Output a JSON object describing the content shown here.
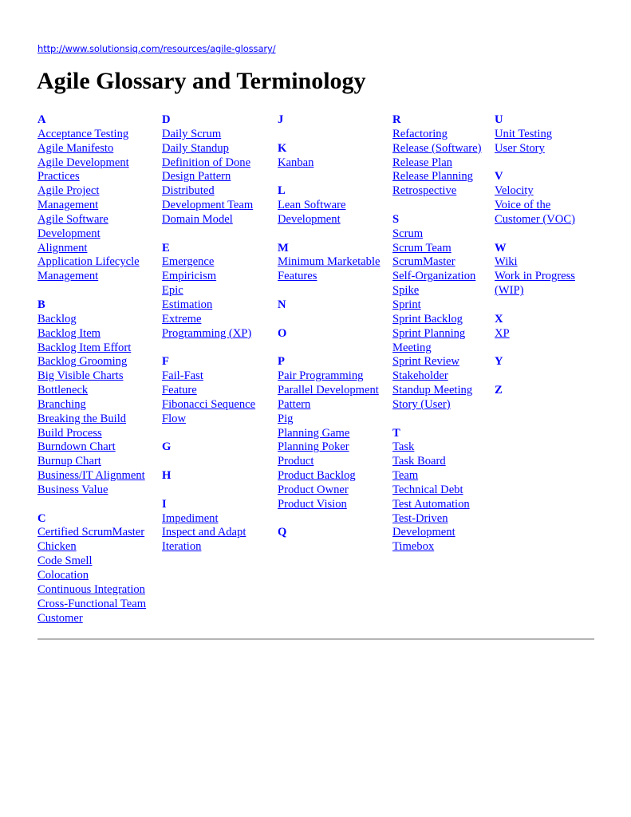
{
  "header": {
    "url": "http://www.solutionsiq.com/resources/agile-glossary/",
    "title": "Agile Glossary and Terminology"
  },
  "colors": {
    "link": "#0000ff",
    "title": "#000000",
    "rule": "#b5b5b5"
  },
  "columns": [
    [
      {
        "letter": "A",
        "terms": [
          [
            "Acceptance Testing"
          ],
          [
            "Agile Manifesto"
          ],
          [
            "Agile Development",
            "Practices"
          ],
          [
            "Agile Project",
            "Management"
          ],
          [
            "Agile Software",
            "Development"
          ],
          [
            "Alignment"
          ],
          [
            "Application Lifecycle",
            "Management"
          ]
        ]
      },
      {
        "letter": "B",
        "terms": [
          [
            "Backlog"
          ],
          [
            "Backlog Item"
          ],
          [
            "Backlog Item Effort"
          ],
          [
            "Backlog Grooming"
          ],
          [
            "Big Visible Charts"
          ],
          [
            "Bottleneck"
          ],
          [
            "Branching"
          ],
          [
            "Breaking the Build"
          ],
          [
            "Build Process"
          ],
          [
            "Burndown Chart"
          ],
          [
            "Burnup Chart"
          ],
          [
            "Business/IT Alignment"
          ],
          [
            "Business Value"
          ]
        ]
      },
      {
        "letter": "C",
        "terms": [
          [
            "Certified ScrumMaster"
          ],
          [
            "Chicken"
          ],
          [
            "Code Smell"
          ],
          [
            "Colocation"
          ],
          [
            "Continuous Integration"
          ],
          [
            "Cross-Functional Team"
          ],
          [
            "Customer"
          ]
        ]
      }
    ],
    [
      {
        "letter": "D",
        "terms": [
          [
            "Daily Scrum"
          ],
          [
            "Daily Standup"
          ],
          [
            "Definition of Done"
          ],
          [
            "Design Pattern"
          ],
          [
            "Distributed",
            "Development Team"
          ],
          [
            "Domain Model"
          ]
        ]
      },
      {
        "letter": "E",
        "terms": [
          [
            "Emergence"
          ],
          [
            "Empiricism"
          ],
          [
            "Epic"
          ],
          [
            "Estimation"
          ],
          [
            "Extreme",
            "Programming (XP)"
          ]
        ]
      },
      {
        "letter": "F",
        "terms": [
          [
            "Fail-Fast"
          ],
          [
            "Feature"
          ],
          [
            "Fibonacci Sequence"
          ],
          [
            "Flow"
          ]
        ]
      },
      {
        "letter": "G",
        "terms": []
      },
      {
        "letter": "H",
        "terms": []
      },
      {
        "letter": "I",
        "terms": [
          [
            "Impediment"
          ],
          [
            "Inspect and Adapt"
          ],
          [
            "Iteration"
          ]
        ]
      }
    ],
    [
      {
        "letter": "J",
        "terms": []
      },
      {
        "letter": "K",
        "terms": [
          [
            "Kanban"
          ]
        ]
      },
      {
        "letter": "L",
        "terms": [
          [
            "Lean Software",
            "Development"
          ]
        ]
      },
      {
        "letter": "M",
        "terms": [
          [
            "Minimum Marketable",
            "Features"
          ]
        ]
      },
      {
        "letter": "N",
        "terms": []
      },
      {
        "letter": "O",
        "terms": []
      },
      {
        "letter": "P",
        "terms": [
          [
            "Pair Programming"
          ],
          [
            "Parallel Development"
          ],
          [
            "Pattern"
          ],
          [
            "Pig"
          ],
          [
            "Planning Game"
          ],
          [
            "Planning Poker"
          ],
          [
            "Product"
          ],
          [
            "Product Backlog"
          ],
          [
            "Product Owner"
          ],
          [
            "Product Vision"
          ]
        ]
      },
      {
        "letter": "Q",
        "terms": []
      }
    ],
    [
      {
        "letter": "R",
        "terms": [
          [
            "Refactoring"
          ],
          [
            "Release (Software)"
          ],
          [
            "Release Plan"
          ],
          [
            "Release Planning"
          ],
          [
            "Retrospective"
          ]
        ]
      },
      {
        "letter": "S",
        "terms": [
          [
            "Scrum"
          ],
          [
            "Scrum Team"
          ],
          [
            "ScrumMaster"
          ],
          [
            "Self-Organization"
          ],
          [
            "Spike"
          ],
          [
            "Sprint"
          ],
          [
            "Sprint Backlog"
          ],
          [
            "Sprint Planning",
            "Meeting"
          ],
          [
            "Sprint Review"
          ],
          [
            "Stakeholder"
          ],
          [
            "Standup Meeting"
          ],
          [
            "Story (User)"
          ]
        ]
      },
      {
        "letter": "T",
        "terms": [
          [
            "Task"
          ],
          [
            "Task Board"
          ],
          [
            "Team"
          ],
          [
            "Technical Debt"
          ],
          [
            "Test Automation"
          ],
          [
            "Test-Driven",
            "Development"
          ],
          [
            "Timebox"
          ]
        ]
      }
    ],
    [
      {
        "letter": "U",
        "terms": [
          [
            "Unit Testing"
          ],
          [
            "User Story"
          ]
        ]
      },
      {
        "letter": "V",
        "terms": [
          [
            "Velocity"
          ],
          [
            "Voice of the",
            "Customer (VOC)"
          ]
        ]
      },
      {
        "letter": "W",
        "terms": [
          [
            "Wiki"
          ],
          [
            "Work in Progress",
            "(WIP)"
          ]
        ]
      },
      {
        "letter": "X",
        "terms": [
          [
            "XP"
          ]
        ]
      },
      {
        "letter": "Y",
        "terms": []
      },
      {
        "letter": "Z",
        "terms": []
      }
    ]
  ]
}
